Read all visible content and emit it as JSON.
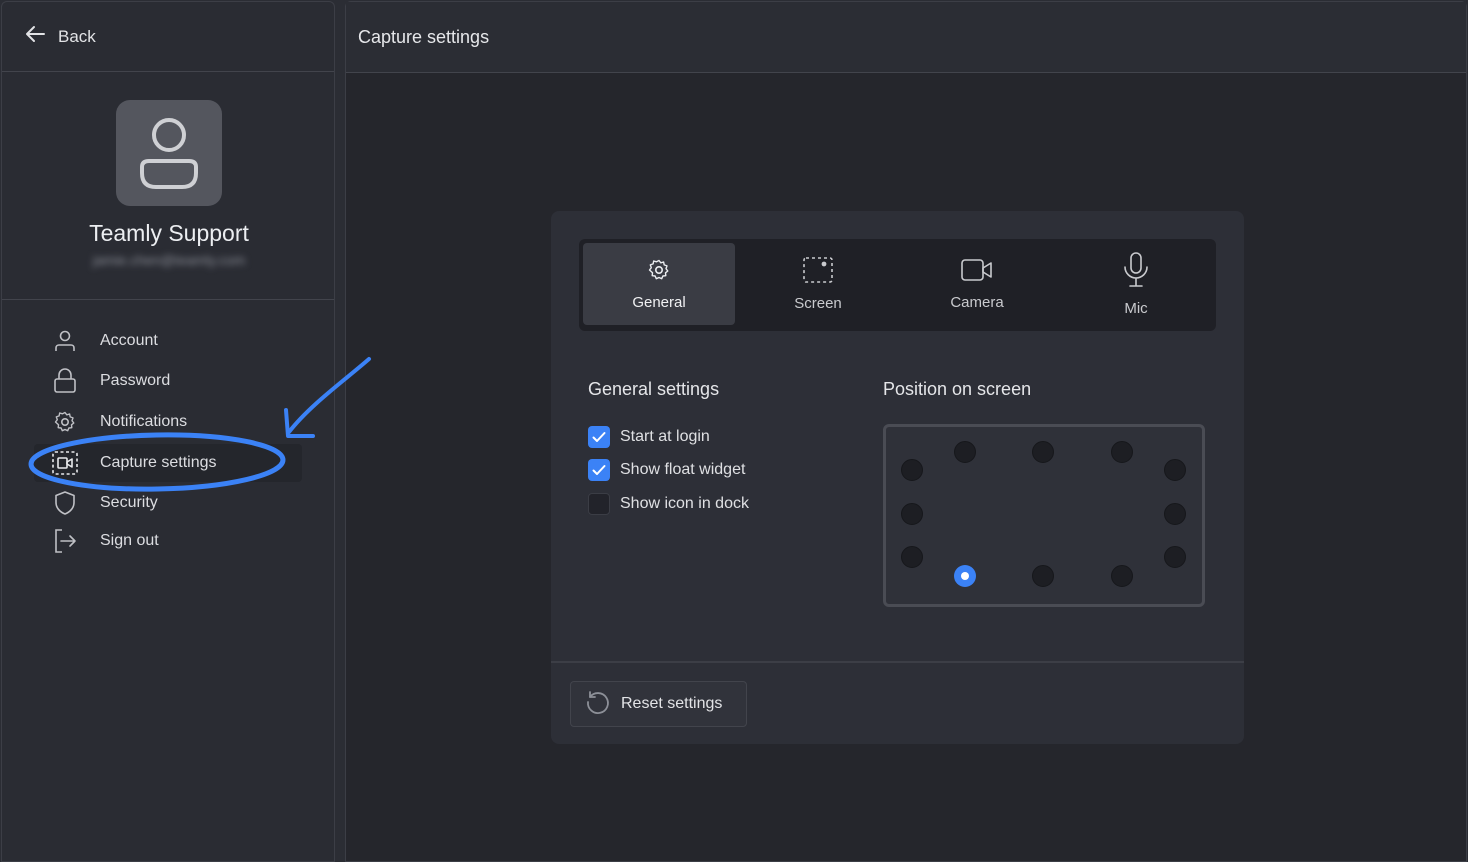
{
  "sidebar": {
    "back_label": "Back",
    "profile": {
      "name": "Teamly Support",
      "email": "jamie.chen@teamly.com"
    },
    "nav_items": [
      {
        "label": "Account",
        "icon": "user-icon"
      },
      {
        "label": "Password",
        "icon": "lock-icon"
      },
      {
        "label": "Notifications",
        "icon": "gear-icon"
      },
      {
        "label": "Capture settings",
        "icon": "capture-icon",
        "active": true
      },
      {
        "label": "Security",
        "icon": "shield-icon"
      },
      {
        "label": "Sign out",
        "icon": "sign-out-icon"
      }
    ]
  },
  "main": {
    "title": "Capture settings",
    "tabs": [
      {
        "label": "General",
        "icon": "gear-icon",
        "active": true
      },
      {
        "label": "Screen",
        "icon": "screen-select-icon"
      },
      {
        "label": "Camera",
        "icon": "camera-icon"
      },
      {
        "label": "Mic",
        "icon": "mic-icon"
      }
    ],
    "general": {
      "title": "General settings",
      "options": [
        {
          "label": "Start at login",
          "checked": true
        },
        {
          "label": "Show float widget",
          "checked": true
        },
        {
          "label": "Show icon in dock",
          "checked": false
        }
      ]
    },
    "position": {
      "title": "Position on screen",
      "selected": "bottom-left"
    },
    "reset_label": "Reset settings"
  },
  "colors": {
    "accent": "#3b82f6",
    "background": "#25262c",
    "card": "#2d2f37",
    "annotation": "#3b82f6"
  }
}
